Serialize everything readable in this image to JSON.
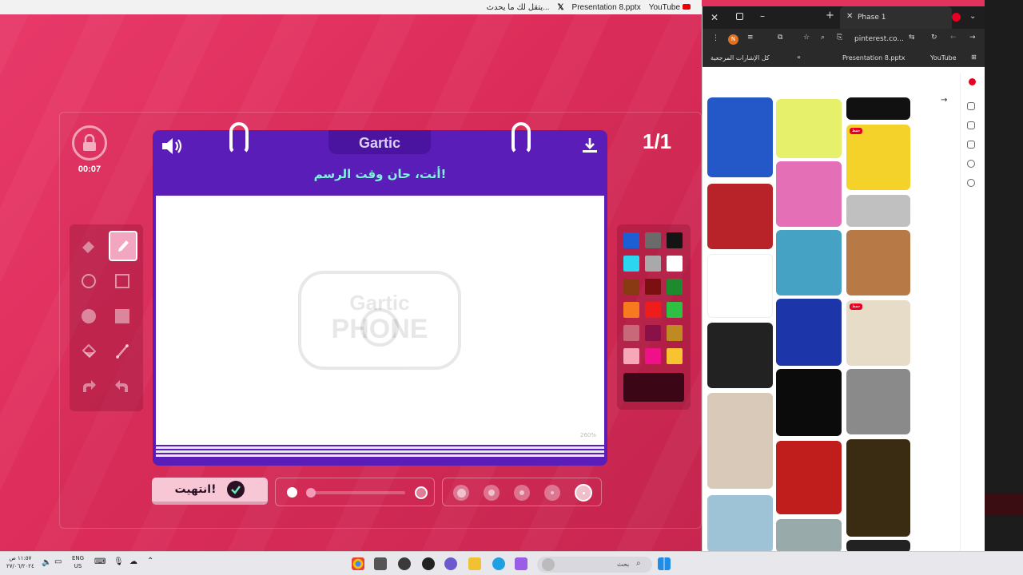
{
  "topstrip": {
    "items": [
      "يتقل لك ما يحدث...",
      "Presentation 8.pptx",
      "YouTube"
    ]
  },
  "game": {
    "timer": "00:07",
    "round_counter": "1/1",
    "logo_tab": "Gartic",
    "subtitle": "أنت، حان وقت الرسم!",
    "watermark_top": "Gartic",
    "watermark_bottom": "PHONE",
    "zoom_label": "260%",
    "done_button": "انتهيت!",
    "palette": [
      "#1c5fd4",
      "#6b6b6b",
      "#141414",
      "#2ad6f0",
      "#a9a9a9",
      "#ffffff",
      "#8a3a12",
      "#7c0f12",
      "#1e8a2e",
      "#f77a1e",
      "#ef1c1c",
      "#2ec043",
      "#c8697a",
      "#8a1048",
      "#c08a22",
      "#f6a7b8",
      "#ef118a",
      "#f8c230"
    ],
    "current_color": "#3b0716",
    "accent": "#5a1db8",
    "brand_teal": "#7ef4e0"
  },
  "browser": {
    "tab_title": "Phase 1",
    "url": "pinterest.co...",
    "bookmarks": [
      "كل الإشارات المرجعية",
      "Presentation 8.pptx",
      "YouTube"
    ],
    "save_badge": "حفظ"
  },
  "taskbar": {
    "time": "١١:٥٧ ص",
    "date": "٢٧/٠٦/٢٠٢٤",
    "lang": "ENG",
    "region": "US",
    "search_placeholder": "بحث"
  }
}
